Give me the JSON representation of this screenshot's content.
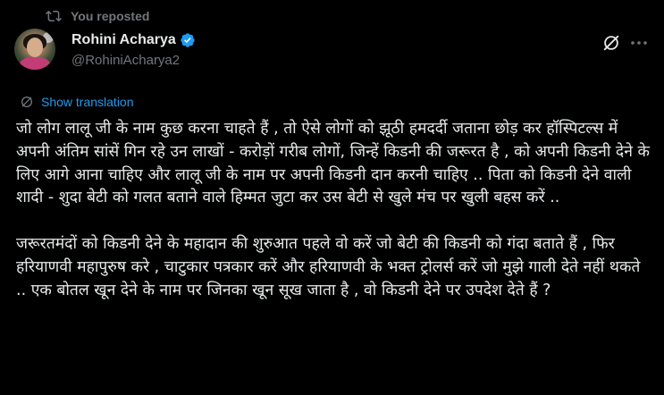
{
  "repost": {
    "label": "You reposted",
    "icon": "repost-icon"
  },
  "author": {
    "name": "Rohini Acharya",
    "handle": "@RohiniAcharya2",
    "verified": true,
    "verified_icon": "verified-badge-icon",
    "verified_color": "#1d9bf0"
  },
  "actions": {
    "grok_icon": "grok-icon",
    "more_icon": "more-dots-icon"
  },
  "translation": {
    "label": "Show translation",
    "icon": "globe-translate-icon",
    "color": "#1d9bf0"
  },
  "post": {
    "paragraphs": [
      "जो लोग लालू जी के नाम कुछ करना चाहते हैं , तो ऐसे लोगों को झूठी हमदर्दी जताना छोड़ कर हॉस्पिटल्स में अपनी अंतिम सांसें गिन रहे उन लाखों - करोड़ों गरीब लोगों, जिन्हें किडनी की जरूरत है , को अपनी किडनी देने के लिए आगे आना चाहिए और लालू जी के नाम पर अपनी किडनी दान करनी चाहिए .. पिता को किडनी देने वाली शादी - शुदा बेटी को गलत बताने वाले हिम्मत जुटा कर उस बेटी से खुले मंच पर खुली बहस करें ..",
      "जरूरतमंदों  को किडनी देने के महादान की शुरुआत पहले वो करें जो बेटी की किडनी को गंदा बताते हैं , फिर हरियाणवी महापुरुष करे , चाटुकार पत्रकार करें और हरियाणवी के भक्त ट्रोलर्स करें जो मुझे गाली देते नहीं थकते .. एक बोतल खून देने के नाम पर जिनका खून सूख जाता है , वो किडनी देने पर उपदेश देते हैं ?"
    ]
  },
  "colors": {
    "background": "#000000",
    "text": "#e7e9ea",
    "muted": "#71767b",
    "accent": "#1d9bf0"
  }
}
